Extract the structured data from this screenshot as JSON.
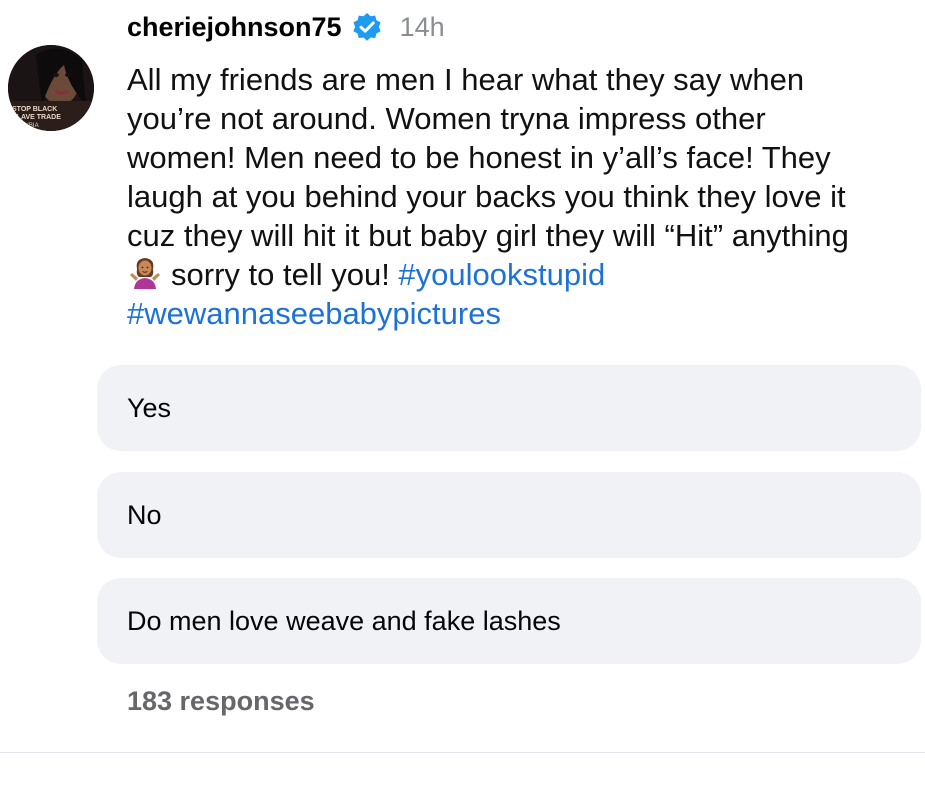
{
  "post": {
    "author": {
      "username": "cheriejohnson75",
      "verified": true,
      "avatar_text": "STOP BLACK SLAVE TRADE LYBIA"
    },
    "timestamp": "14h",
    "text_lines": [
      "All my friends are men I hear what they say when",
      "you’re not around. Women tryna impress other",
      "women! Men need to be honest in y’all’s face! They",
      "laugh at you behind your backs you think they love it",
      "cuz they will hit it but baby girl they will “Hit” anything"
    ],
    "last_line_text": "sorry to tell you! ",
    "emoji": "person-shrugging-emoji",
    "hashtags": [
      "#youlookstupid",
      "#wewannaseebabypictures"
    ]
  },
  "poll": {
    "options": [
      {
        "label": "Yes"
      },
      {
        "label": "No"
      },
      {
        "label": "Do men love weave and fake lashes"
      }
    ],
    "responses_label": "183 responses"
  },
  "colors": {
    "hashtag": "#1d72d8",
    "verified_badge": "#1d9bf0",
    "poll_option_bg": "#f0f2f5",
    "muted_text": "#65676b"
  }
}
